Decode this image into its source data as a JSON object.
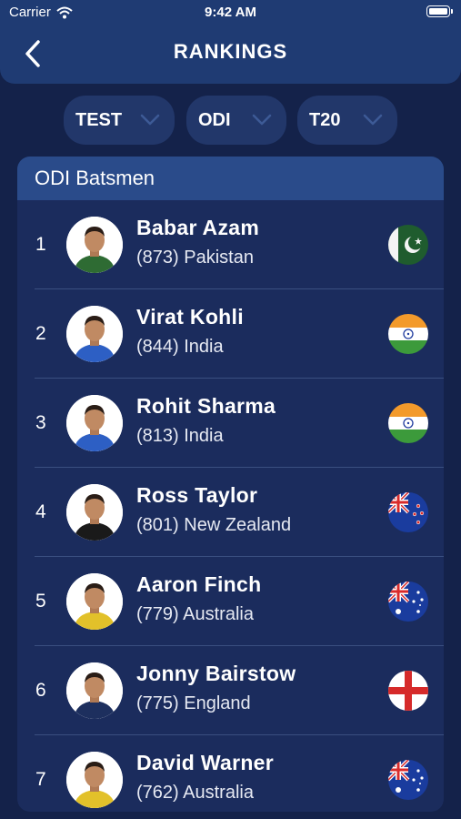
{
  "status": {
    "carrier": "Carrier",
    "time": "9:42 AM"
  },
  "header": {
    "title": "RANKINGS",
    "back_icon": "chevron-left-icon"
  },
  "tabs": [
    {
      "label": "TEST"
    },
    {
      "label": "ODI"
    },
    {
      "label": "T20"
    }
  ],
  "card": {
    "title": "ODI Batsmen"
  },
  "players": [
    {
      "rank": "1",
      "name": "Babar Azam",
      "info": "(873) Pakistan",
      "flag": "pakistan-flag-icon",
      "jersey": "#2e6b33"
    },
    {
      "rank": "2",
      "name": "Virat Kohli",
      "info": "(844) India",
      "flag": "india-flag-icon",
      "jersey": "#2d5fc4"
    },
    {
      "rank": "3",
      "name": "Rohit Sharma",
      "info": "(813) India",
      "flag": "india-flag-icon",
      "jersey": "#2d5fc4"
    },
    {
      "rank": "4",
      "name": "Ross Taylor",
      "info": "(801) New Zealand",
      "flag": "new-zealand-flag-icon",
      "jersey": "#1a1a1a"
    },
    {
      "rank": "5",
      "name": "Aaron Finch",
      "info": "(779) Australia",
      "flag": "australia-flag-icon",
      "jersey": "#e2c12a"
    },
    {
      "rank": "6",
      "name": "Jonny Bairstow",
      "info": "(775) England",
      "flag": "england-flag-icon",
      "jersey": "#1d2f5e"
    },
    {
      "rank": "7",
      "name": "David Warner",
      "info": "(762) Australia",
      "flag": "australia-flag-icon",
      "jersey": "#e2c12a"
    }
  ],
  "colors": {
    "background": "#14224a",
    "navbar": "#1f3b73",
    "card": "#1b2c5d",
    "card_header": "#2a4b8a",
    "tab": "#22376a"
  }
}
